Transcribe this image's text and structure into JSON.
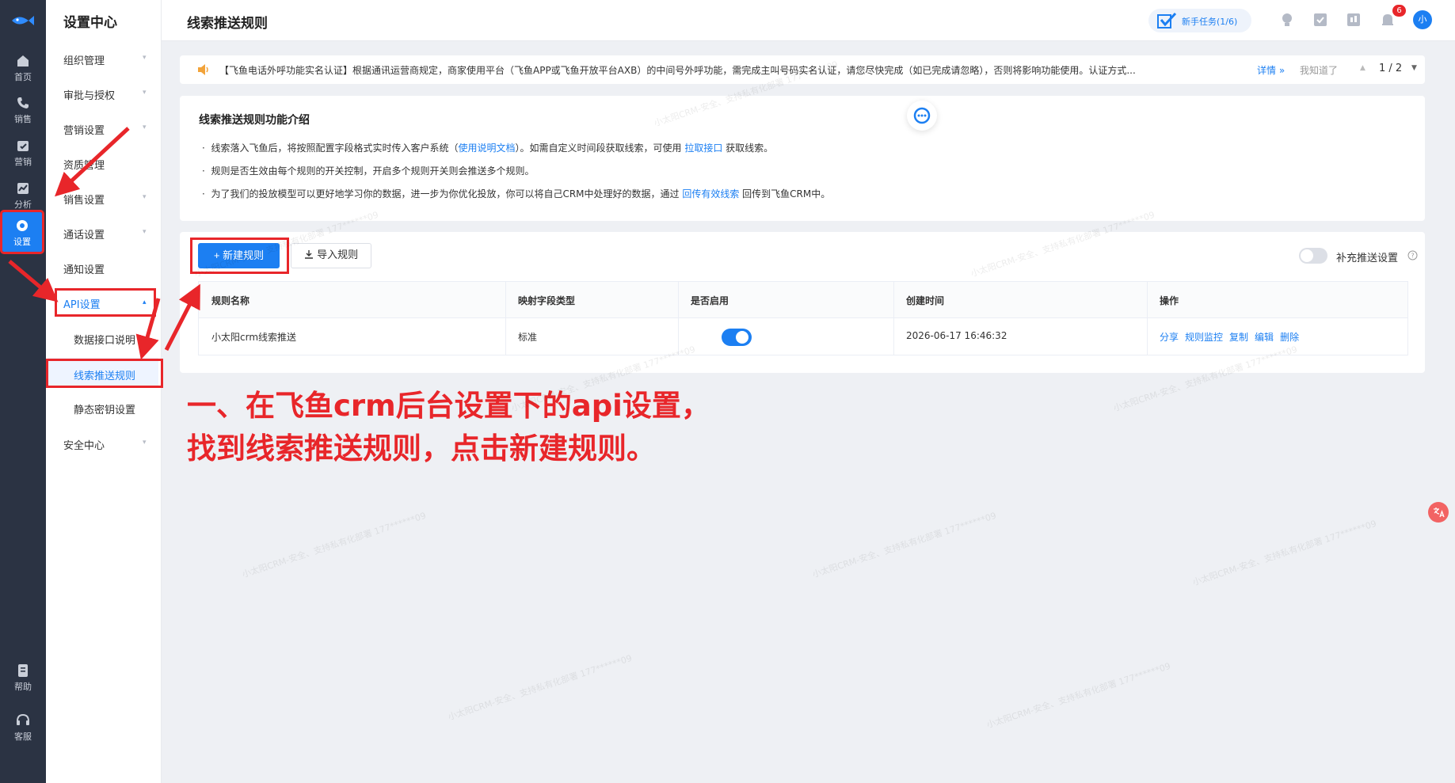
{
  "rail": {
    "home": "首页",
    "sales": "销售",
    "marketing": "营销",
    "analysis": "分析",
    "settings": "设置",
    "help": "帮助",
    "service": "客服"
  },
  "submenu": {
    "title": "设置中心",
    "items": [
      {
        "label": "组织管理",
        "arrow": "▾"
      },
      {
        "label": "审批与授权",
        "arrow": "▾"
      },
      {
        "label": "营销设置",
        "arrow": "▾"
      },
      {
        "label": "资质管理",
        "arrow": ""
      },
      {
        "label": "销售设置",
        "arrow": "▾"
      },
      {
        "label": "通话设置",
        "arrow": "▾"
      },
      {
        "label": "通知设置",
        "arrow": ""
      },
      {
        "label": "API设置",
        "arrow": "▴"
      }
    ],
    "api_children": [
      "数据接口说明",
      "线索推送规则",
      "静态密钥设置"
    ],
    "security": "安全中心",
    "security_arrow": "▾"
  },
  "topbar": {
    "title": "线索推送规则",
    "task": "新手任务(1/6)",
    "badge": "6",
    "avatar": "小"
  },
  "notice": {
    "text": "【飞鱼电话外呼功能实名认证】根据通讯运营商规定，商家使用平台（飞鱼APP或飞鱼开放平台AXB）的中间号外呼功能，需完成主叫号码实名认证，请您尽快完成（如已完成请忽略），否则将影响功能使用。认证方式...",
    "detail": "详情 »",
    "dismiss": "我知道了",
    "page": "1 / 2"
  },
  "intro": {
    "title": "线索推送规则功能介绍",
    "b1_pre": "线索落入飞鱼后，将按照配置字段格式实时传入客户系统（",
    "b1_link1": "使用说明文档",
    "b1_mid": "）。如需自定义时间段获取线索，可使用 ",
    "b1_link2": "拉取接口",
    "b1_post": " 获取线索。",
    "b2": "规则是否生效由每个规则的开关控制，开启多个规则开关则会推送多个规则。",
    "b3_pre": "为了我们的投放模型可以更好地学习你的数据，进一步为你优化投放，你可以将自己CRM中处理好的数据，通过 ",
    "b3_link": "回传有效线索",
    "b3_post": " 回传到飞鱼CRM中。"
  },
  "rules": {
    "new_btn": "+ 新建规则",
    "import_btn": "导入规则",
    "supp_label": "补充推送设置",
    "supp_on": false,
    "headers": [
      "规则名称",
      "映射字段类型",
      "是否启用",
      "创建时间",
      "操作"
    ],
    "rows": [
      {
        "name": "小太阳crm线索推送",
        "type": "标准",
        "enabled": true,
        "created": "2026-06-17 16:46:32"
      }
    ],
    "ops": [
      "分享",
      "规则监控",
      "复制",
      "编辑",
      "删除"
    ]
  },
  "annotation": {
    "line1": "一、在飞鱼crm后台设置下的api设置，",
    "line2": "找到线索推送规则，点击新建规则。"
  },
  "watermark": "小太阳CRM-安全、支持私有化部署 177******09",
  "colors": {
    "accent": "#1c7ff2",
    "rail": "#2b3343",
    "annotation": "#e8262a"
  }
}
